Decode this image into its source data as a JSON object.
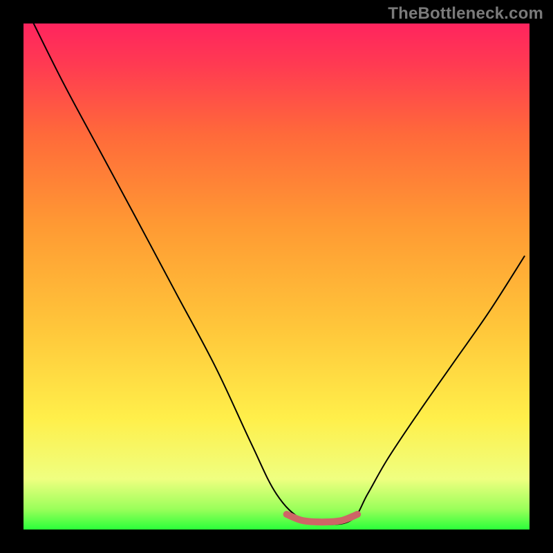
{
  "watermark": "TheBottleneck.com",
  "chart_data": {
    "type": "line",
    "title": "",
    "xlabel": "",
    "ylabel": "",
    "xlim": [
      0,
      1
    ],
    "ylim": [
      0,
      1
    ],
    "background_gradient": {
      "stops": [
        {
          "offset": 0.0,
          "color": "#2aff3a"
        },
        {
          "offset": 0.04,
          "color": "#9aff5a"
        },
        {
          "offset": 0.1,
          "color": "#efff80"
        },
        {
          "offset": 0.22,
          "color": "#ffef4a"
        },
        {
          "offset": 0.4,
          "color": "#ffc63a"
        },
        {
          "offset": 0.6,
          "color": "#ff9a33"
        },
        {
          "offset": 0.78,
          "color": "#ff6a3a"
        },
        {
          "offset": 0.92,
          "color": "#ff3a52"
        },
        {
          "offset": 1.0,
          "color": "#ff245e"
        }
      ]
    },
    "series": [
      {
        "name": "bottleneck-curve",
        "color": "#000000",
        "x": [
          0.02,
          0.08,
          0.15,
          0.22,
          0.3,
          0.38,
          0.45,
          0.5,
          0.55,
          0.6,
          0.65,
          0.68,
          0.72,
          0.78,
          0.85,
          0.92,
          0.99
        ],
        "y": [
          1.0,
          0.88,
          0.75,
          0.62,
          0.47,
          0.32,
          0.17,
          0.07,
          0.02,
          0.01,
          0.02,
          0.07,
          0.14,
          0.23,
          0.33,
          0.43,
          0.54
        ]
      },
      {
        "name": "optimal-flat-region",
        "color": "#ce6666",
        "x": [
          0.52,
          0.55,
          0.58,
          0.6,
          0.63,
          0.66
        ],
        "y": [
          0.03,
          0.018,
          0.015,
          0.015,
          0.018,
          0.03
        ]
      }
    ]
  }
}
